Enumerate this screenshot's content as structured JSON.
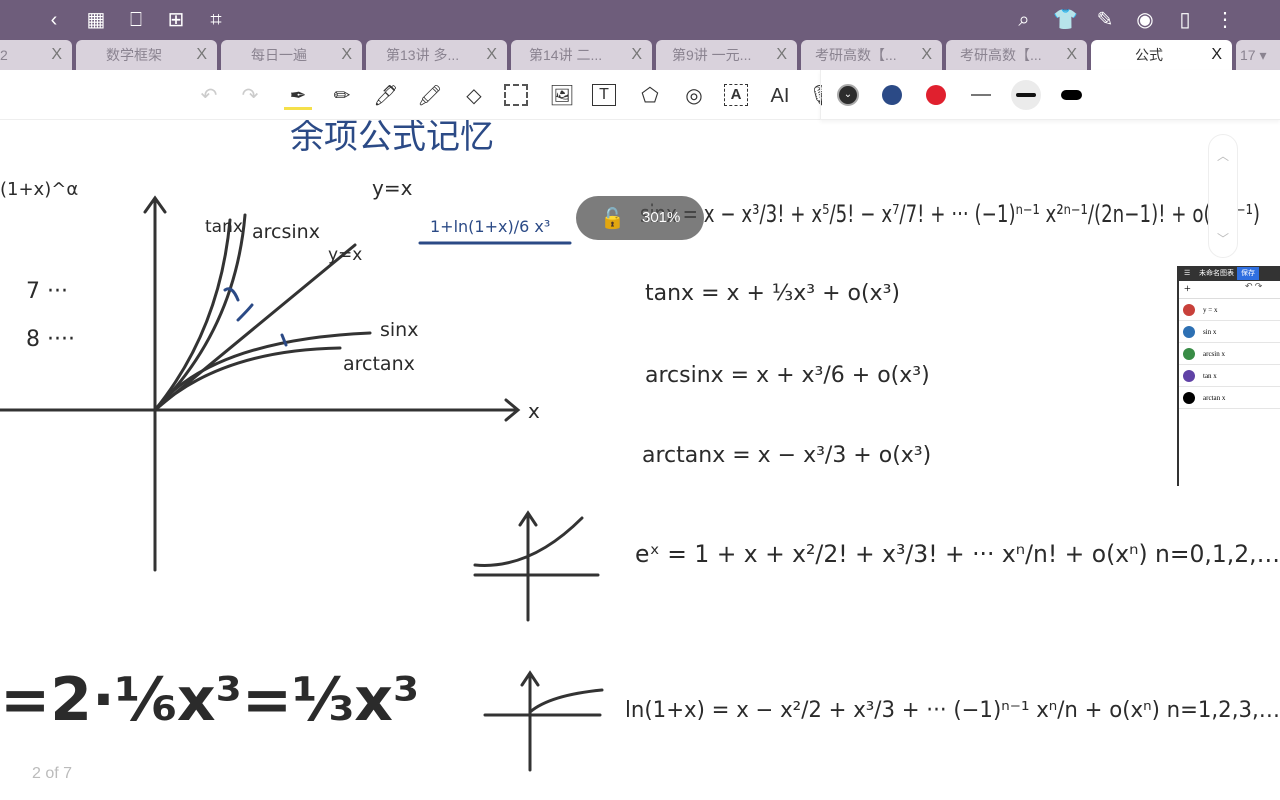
{
  "topbar": {
    "icons": [
      "back-icon",
      "grid-icon",
      "bookmark-icon",
      "add-page-icon",
      "crop-icon",
      "search-icon",
      "shirt-icon",
      "pen-edit-icon",
      "eye-icon",
      "document-icon",
      "more-icon"
    ]
  },
  "tabs": [
    {
      "label": "2"
    },
    {
      "label": "数学框架"
    },
    {
      "label": "每日一遍"
    },
    {
      "label": "第13讲 多..."
    },
    {
      "label": "第14讲 二..."
    },
    {
      "label": "第9讲 一元..."
    },
    {
      "label": "考研高数【..."
    },
    {
      "label": "考研高数【..."
    },
    {
      "label": "公式",
      "active": true
    },
    {
      "label": "17 ▾"
    }
  ],
  "tab_close": "X",
  "toolbar": {
    "tools": [
      "undo-icon",
      "redo-icon",
      "fountain-pen-icon",
      "pencil-icon",
      "ballpoint-pen-icon",
      "highlighter-icon",
      "eraser-icon",
      "lasso-select-icon",
      "image-icon",
      "text-box-icon",
      "shapes-icon",
      "tape-icon",
      "ocr-text-icon",
      "ai-icon",
      "microphone-icon"
    ],
    "ai_label": "AI",
    "text_label": "T",
    "ocr_label": "A"
  },
  "colors": {
    "selected": "#2d2d2d",
    "swatches": [
      "#2d2d2d",
      "#2b4a86",
      "#e0202e"
    ],
    "accent_highlight": "#f5e04a"
  },
  "lock": {
    "zoom": "301%"
  },
  "pager": "2 of 7",
  "graph_panel": {
    "title": "未命名图表",
    "save": "保存",
    "add": "+",
    "functions": [
      {
        "label": "y = x",
        "color": "#c8403a"
      },
      {
        "label": "sin x",
        "color": "#2d70b3"
      },
      {
        "label": "arcsin x",
        "color": "#388c46"
      },
      {
        "label": "tan x",
        "color": "#6042a6"
      },
      {
        "label": "arctan x",
        "color": "#000000"
      }
    ]
  },
  "notes": {
    "header": "余项公式记忆",
    "topleft": "(1+x)^α",
    "y_eq_x": "y=x",
    "boxed": "1+ln(1+x)/6 x³",
    "sin": "sinx = x − x³/3! + x⁵/5! − x⁷/7! + ··· (−1)ⁿ⁻¹ x²ⁿ⁻¹/(2n−1)! + o(x²ⁿ⁻¹)",
    "tan": "tanx = x + ⅓x³ + o(x³)",
    "arcsin": "arcsinx = x + x³/6 + o(x³)",
    "arctan": "arctanx = x − x³/3 + o(x³)",
    "exp": "eˣ = 1 + x + x²/2! + x³/3! + ··· xⁿ/n! + o(xⁿ)   n=0,1,2,…",
    "ln": "ln(1+x) = x − x²/2 + x³/3 + ··· (−1)ⁿ⁻¹ xⁿ/n + o(xⁿ)   n=1,2,3,…",
    "bottom": "=2·⅙x³=⅓x³",
    "num7": "7 ···",
    "num8": "8 ····",
    "graph": {
      "tan": "tanx",
      "arcsin": "arcsinx",
      "yx": "y=x",
      "sin": "sinx",
      "arctan": "arctanx",
      "xaxis": "x"
    }
  }
}
